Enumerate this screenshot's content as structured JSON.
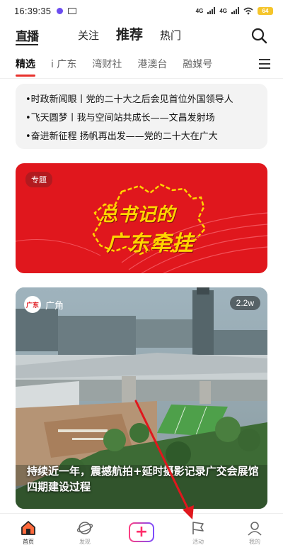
{
  "status_bar": {
    "time": "16:39:35",
    "network_1": "4G",
    "network_2": "4G",
    "battery": "64"
  },
  "header": {
    "logo": "直播",
    "tabs": [
      {
        "label": "关注"
      },
      {
        "label": "推荐"
      },
      {
        "label": "热门"
      }
    ],
    "active_tab": "推荐"
  },
  "channels": {
    "items": [
      {
        "label": "精选"
      },
      {
        "label": "i 广东"
      },
      {
        "label": "湾财社"
      },
      {
        "label": "港澳台"
      },
      {
        "label": "融媒号"
      }
    ],
    "active": "精选"
  },
  "news_ticker": {
    "lines": [
      "•时政新闻眼丨党的二十大之后会见首位外国领导人",
      "•飞天圆梦丨我与空间站共成长——文昌发射场",
      "•奋进新征程 扬帆再出发——党的二十大在广大"
    ]
  },
  "banner": {
    "tag": "专题",
    "title_line1": "总书记的",
    "title_line2": "广东牵挂",
    "colors": {
      "background": "#e0171d",
      "title": "#ffd400"
    }
  },
  "video_card": {
    "source_name": "广角",
    "source_avatar": "广东",
    "views": "2.2w",
    "title": "持续近一年，震撼航拍+延时摄影记录广交会展馆四期建设过程"
  },
  "bottom_nav": {
    "items": [
      {
        "label": "首页",
        "icon": "home-icon",
        "active": true
      },
      {
        "label": "发现",
        "icon": "planet-icon",
        "active": false
      },
      {
        "label": "",
        "icon": "publish-plus-icon",
        "active": false
      },
      {
        "label": "活动",
        "icon": "flag-icon",
        "active": false
      },
      {
        "label": "我的",
        "icon": "profile-icon",
        "active": false
      }
    ],
    "publish_symbol": "+"
  },
  "annotation": {
    "type": "red-arrow",
    "color": "#e0171d",
    "points_to": "活动"
  }
}
